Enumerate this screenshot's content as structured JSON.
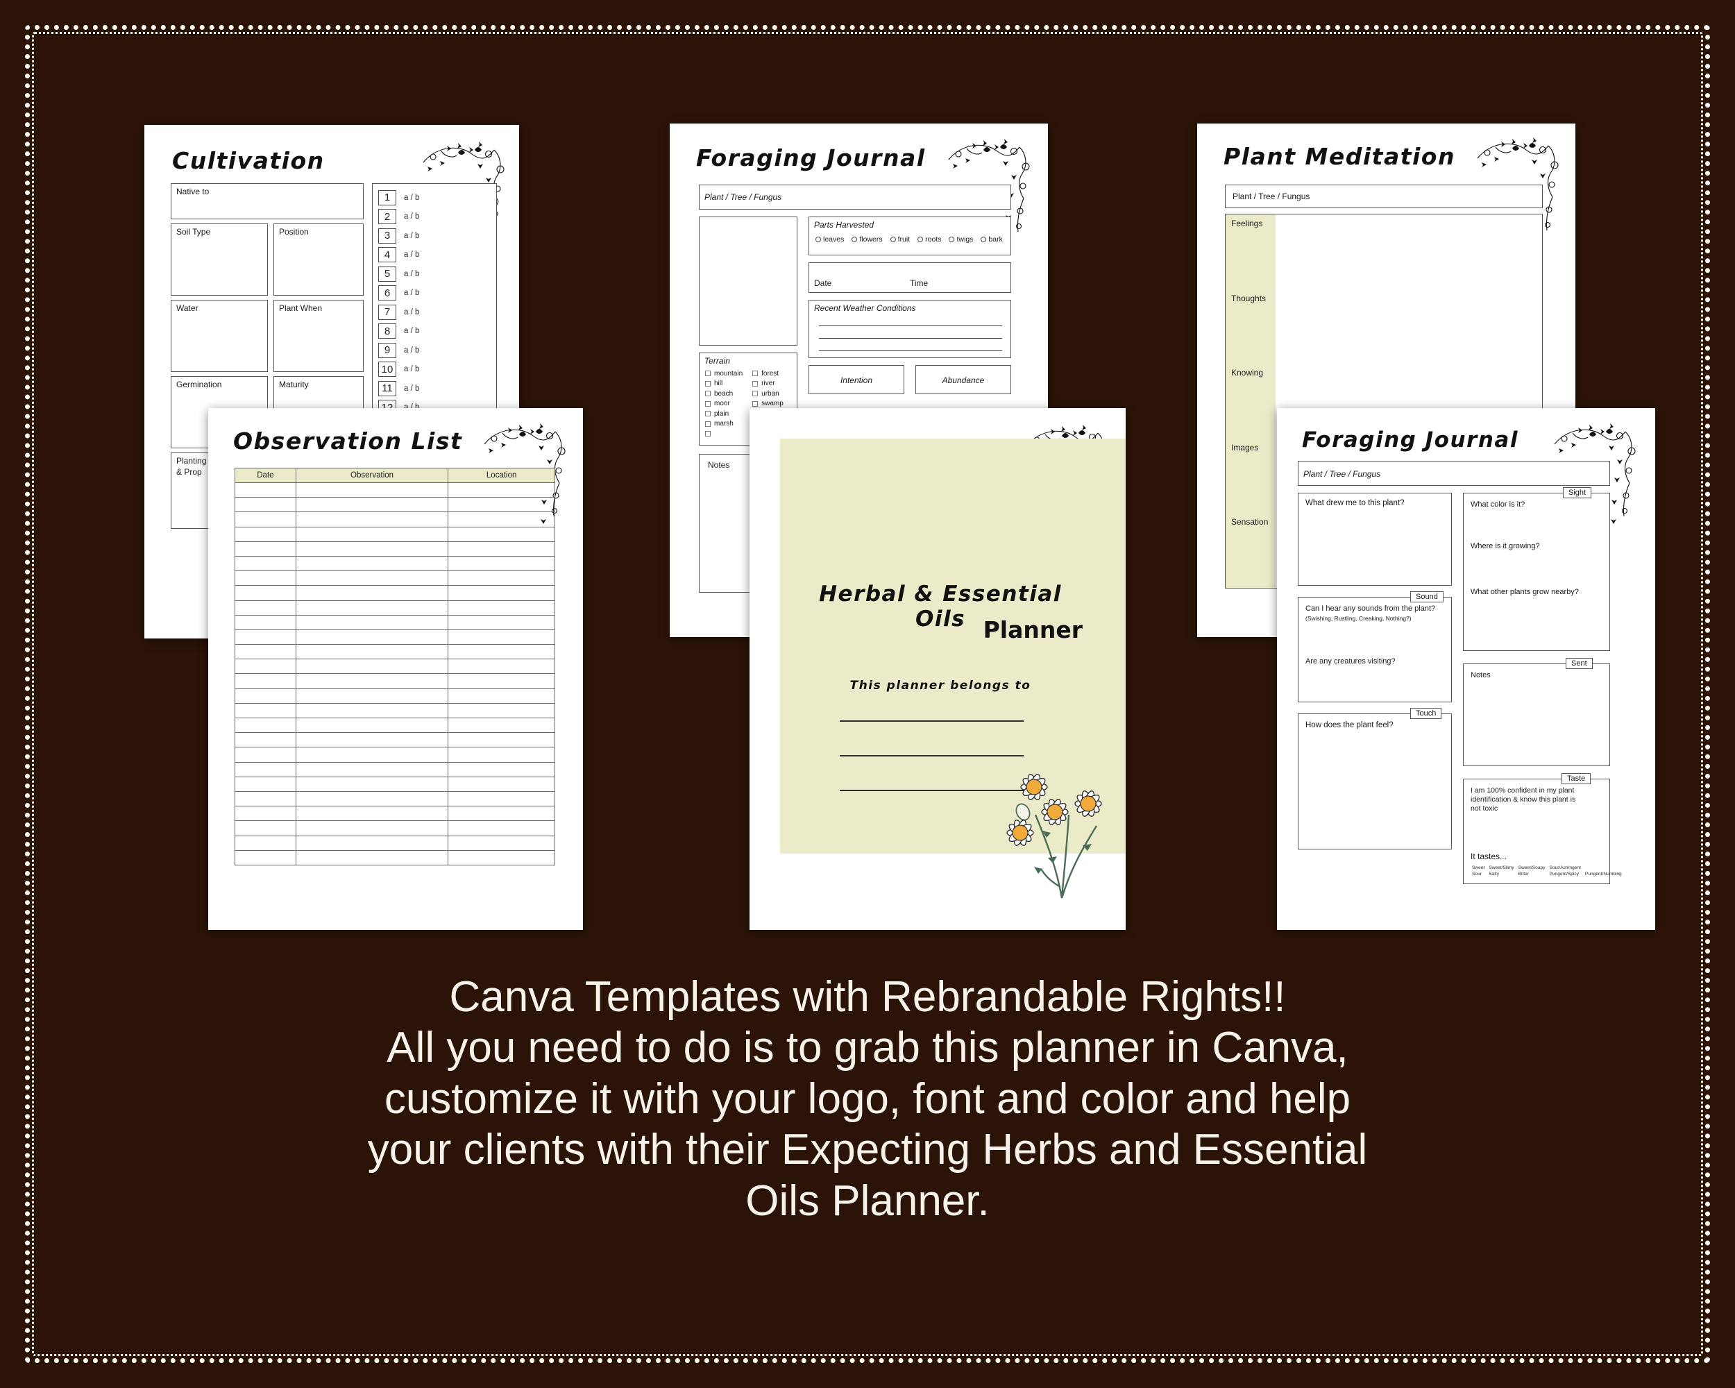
{
  "theme": {
    "background": "#2b1407",
    "paper": "#ffffff",
    "accent_cream": "#ebebc9",
    "caption_color": "#f7f2ea",
    "flower_center": "#f0a93b",
    "stem_green": "#4c6b57"
  },
  "caption": {
    "lines": [
      "Canva Templates with Rebrandable Rights!!",
      "All you need to do is to grab this planner in Canva,",
      "customize it with your logo, font and color and help",
      "your clients with their Expecting Herbs and Essential",
      "Oils Planner."
    ]
  },
  "pages": {
    "cultivation": {
      "title": "Cultivation",
      "fields": {
        "native_to": "Native to",
        "soil_type": "Soil Type",
        "position": "Position",
        "water": "Water",
        "plant_when": "Plant When",
        "germination": "Germination",
        "maturity": "Maturity",
        "planting": "Planting",
        "propagation": "& Prop"
      },
      "numbered_list": {
        "numbers": [
          "1",
          "2",
          "3",
          "4",
          "5",
          "6",
          "7",
          "8",
          "9",
          "10",
          "11",
          "12"
        ],
        "option_label": "a / b"
      }
    },
    "foraging_journal_1": {
      "title": "Foraging Journal",
      "plant_field": "Plant / Tree / Fungus",
      "parts_harvested": {
        "label": "Parts Harvested",
        "options": [
          "leaves",
          "flowers",
          "fruit",
          "roots",
          "twigs",
          "bark"
        ]
      },
      "date_label": "Date",
      "time_label": "Time",
      "weather_label": "Recent Weather Conditions",
      "terrain": {
        "label": "Terrain",
        "column_1": [
          "mountain",
          "hill",
          "beach",
          "moor",
          "plain",
          "marsh",
          ""
        ],
        "column_2": [
          "forest",
          "river",
          "urban",
          "swamp"
        ]
      },
      "intention_label": "Intention",
      "abundance_label": "Abundance",
      "notes_label": "Notes"
    },
    "plant_meditation": {
      "title": "Plant Meditation",
      "plant_field": "Plant / Tree / Fungus",
      "sections": [
        "Feelings",
        "Thoughts",
        "Knowing",
        "Images",
        "Sensation"
      ]
    },
    "observation_list": {
      "title": "Observation List",
      "columns": [
        "Date",
        "Observation",
        "Location"
      ],
      "row_count": 26
    },
    "cover": {
      "title": "Herbal & Essential Oils",
      "subtitle": "Planner",
      "belongs_to": "This planner belongs to",
      "line_count": 3
    },
    "foraging_journal_2": {
      "title": "Foraging Journal",
      "plant_field": "Plant / Tree / Fungus",
      "prompts": {
        "drew_me": "What drew me to this plant?",
        "sound_tab": "Sound",
        "sound_q": "Can I hear any sounds from the plant?",
        "sound_hint": "(Swishing, Rustling, Creaking, Nothing?)",
        "creatures": "Are any creatures visiting?",
        "touch_tab": "Touch",
        "touch_q": "How does the plant feel?",
        "sight_tab": "Sight",
        "color_q": "What color is it?",
        "growing_q": "Where is it growing?",
        "nearby_q": "What other plants grow nearby?",
        "scent_tab": "Sent",
        "notes_label": "Notes",
        "taste_tab": "Taste",
        "confidence": "I am 100% confident in my plant identification & know this plant is not toxic",
        "it_tastes": "It tastes...",
        "taste_options": [
          "Sweet",
          "Sweet/Slimy",
          "Sweet/Soapy",
          "Sour/Astringent",
          "",
          "Sour",
          "Salty",
          "Bitter",
          "Pungent/Spicy",
          "Pungent/Numbing"
        ]
      }
    }
  }
}
